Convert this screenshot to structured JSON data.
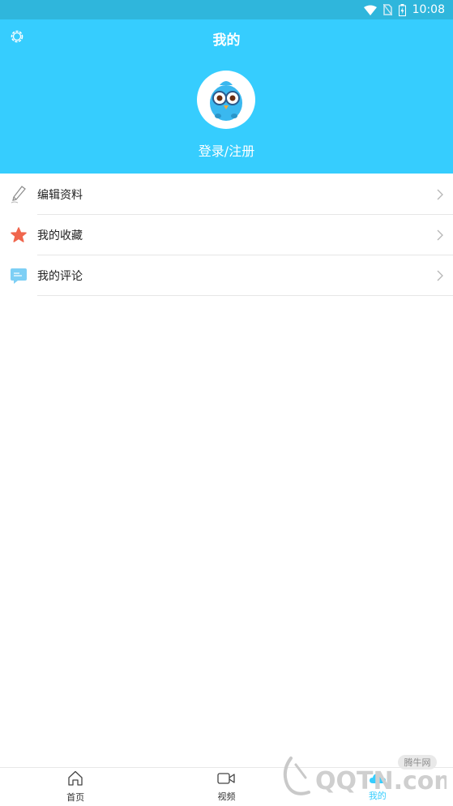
{
  "status_bar": {
    "time": "10:08"
  },
  "header": {
    "title": "我的",
    "login_label": "登录/注册"
  },
  "menu": {
    "items": [
      {
        "label": "编辑资料",
        "icon": "pencil-icon"
      },
      {
        "label": "我的收藏",
        "icon": "star-icon"
      },
      {
        "label": "我的评论",
        "icon": "comment-icon"
      }
    ]
  },
  "bottom_nav": {
    "tabs": [
      {
        "label": "首页",
        "icon": "home-icon"
      },
      {
        "label": "视频",
        "icon": "video-icon"
      },
      {
        "label": "我的",
        "icon": "cloud-icon"
      }
    ]
  },
  "watermark": {
    "site_cn": "腾牛网",
    "site_en": "QQTN.com"
  },
  "colors": {
    "accent": "#36cdfe",
    "status_bar": "#2fb6dc",
    "star": "#f0664d",
    "comment": "#5fc0f0"
  }
}
